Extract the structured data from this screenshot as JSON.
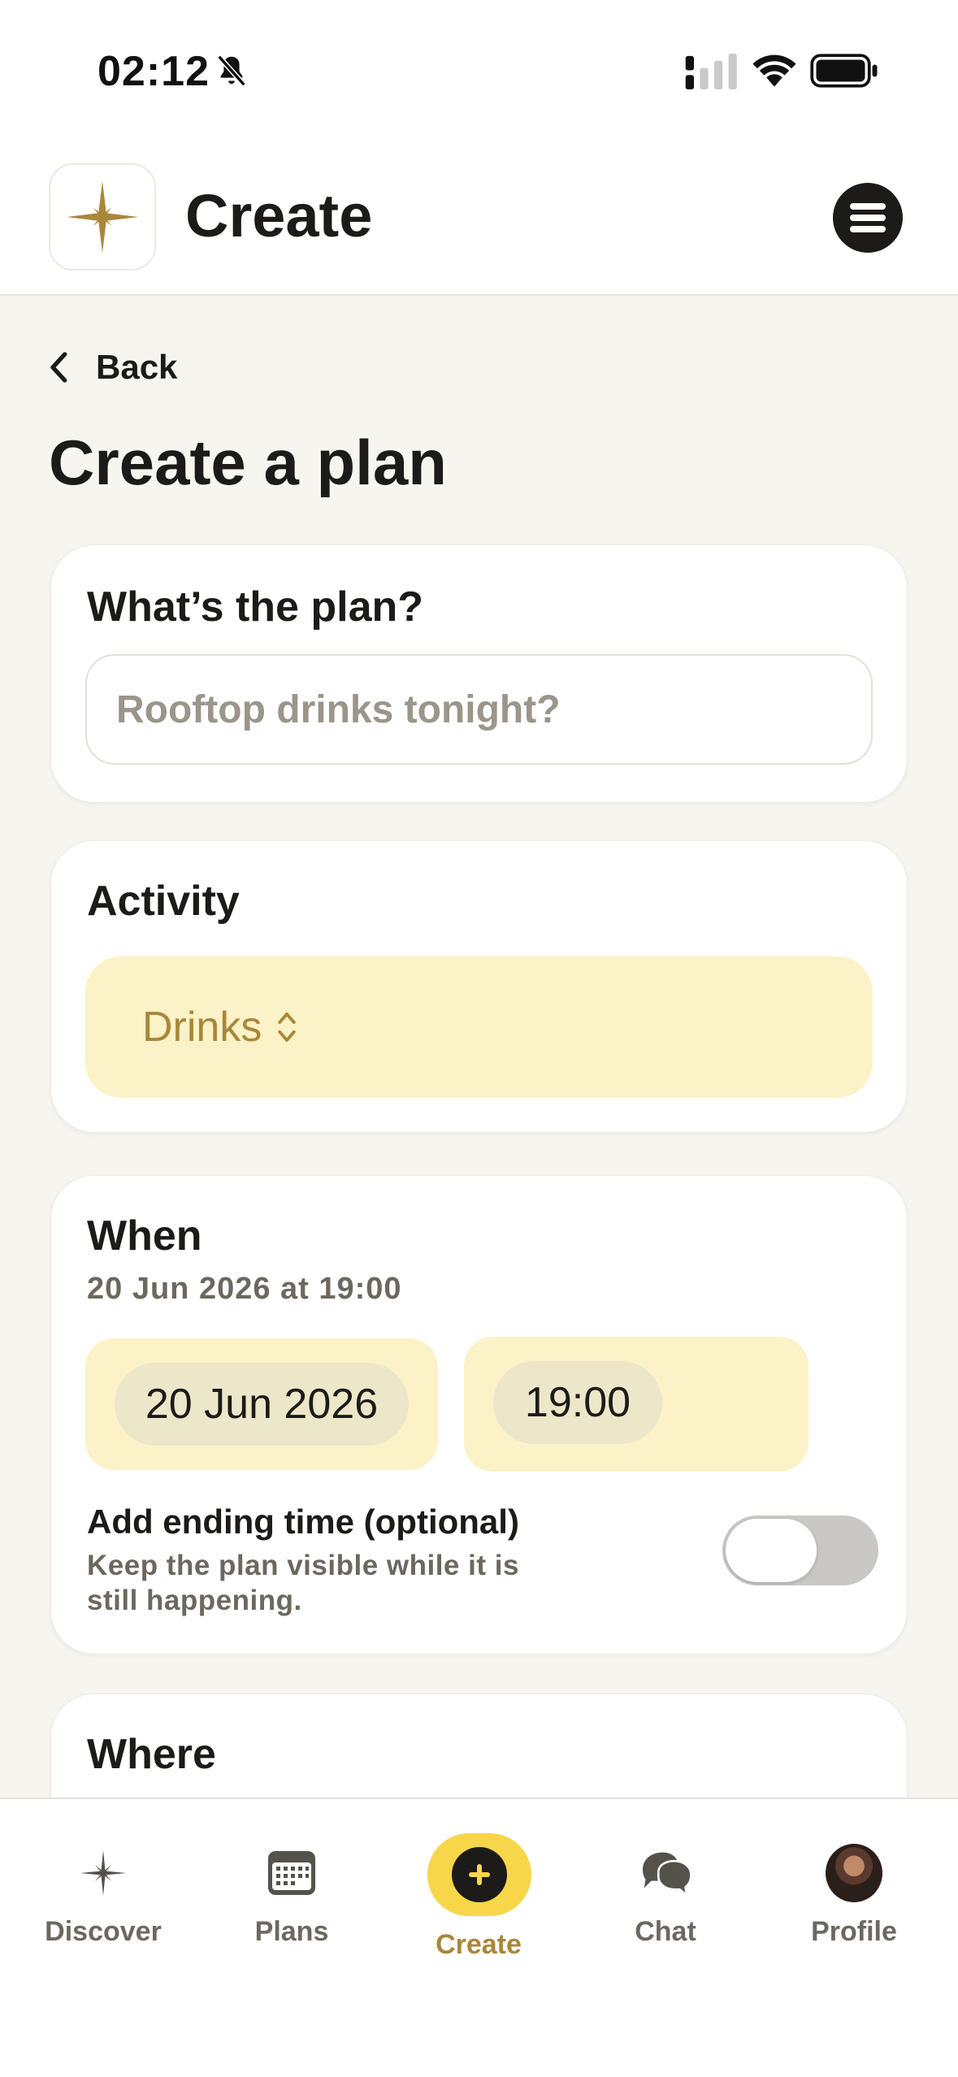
{
  "status_bar": {
    "time": "02:12",
    "icons": [
      "bell-slash-icon",
      "signal-icon",
      "wifi-icon",
      "battery-icon"
    ]
  },
  "header": {
    "title": "Create",
    "logo_icon": "four-point-star-icon",
    "menu_icon": "hamburger-menu-icon"
  },
  "back": {
    "label": "Back",
    "icon": "chevron-left-icon"
  },
  "page_title": "Create a plan",
  "plan_card": {
    "title": "What’s the plan?",
    "input_value": "",
    "input_placeholder": "Rooftop drinks tonight?"
  },
  "activity_card": {
    "title": "Activity",
    "selected": "Drinks",
    "icon": "chevron-up-down-icon"
  },
  "when_card": {
    "title": "When",
    "summary": "20 Jun 2026 at 19:00",
    "date": "20 Jun 2026",
    "time": "19:00",
    "ending_title": "Add ending time (optional)",
    "ending_desc": "Keep the plan visible while it is still happening.",
    "ending_enabled": false
  },
  "where_card": {
    "title": "Where"
  },
  "bottom_nav": {
    "items": [
      {
        "label": "Discover",
        "icon": "sparkle-star-icon",
        "active": false
      },
      {
        "label": "Plans",
        "icon": "calendar-icon",
        "active": false
      },
      {
        "label": "Create",
        "icon": "plus-circle-icon",
        "active": true
      },
      {
        "label": "Chat",
        "icon": "chat-bubbles-icon",
        "active": false
      },
      {
        "label": "Profile",
        "icon": "avatar",
        "active": false
      }
    ]
  },
  "colors": {
    "accent_gold": "#a9873a",
    "accent_yellow": "#f7d64a",
    "pale_yellow": "#fcf2c7",
    "text_dark": "#1c1b19",
    "text_muted": "#6d685f",
    "background": "#f7f5f0"
  }
}
